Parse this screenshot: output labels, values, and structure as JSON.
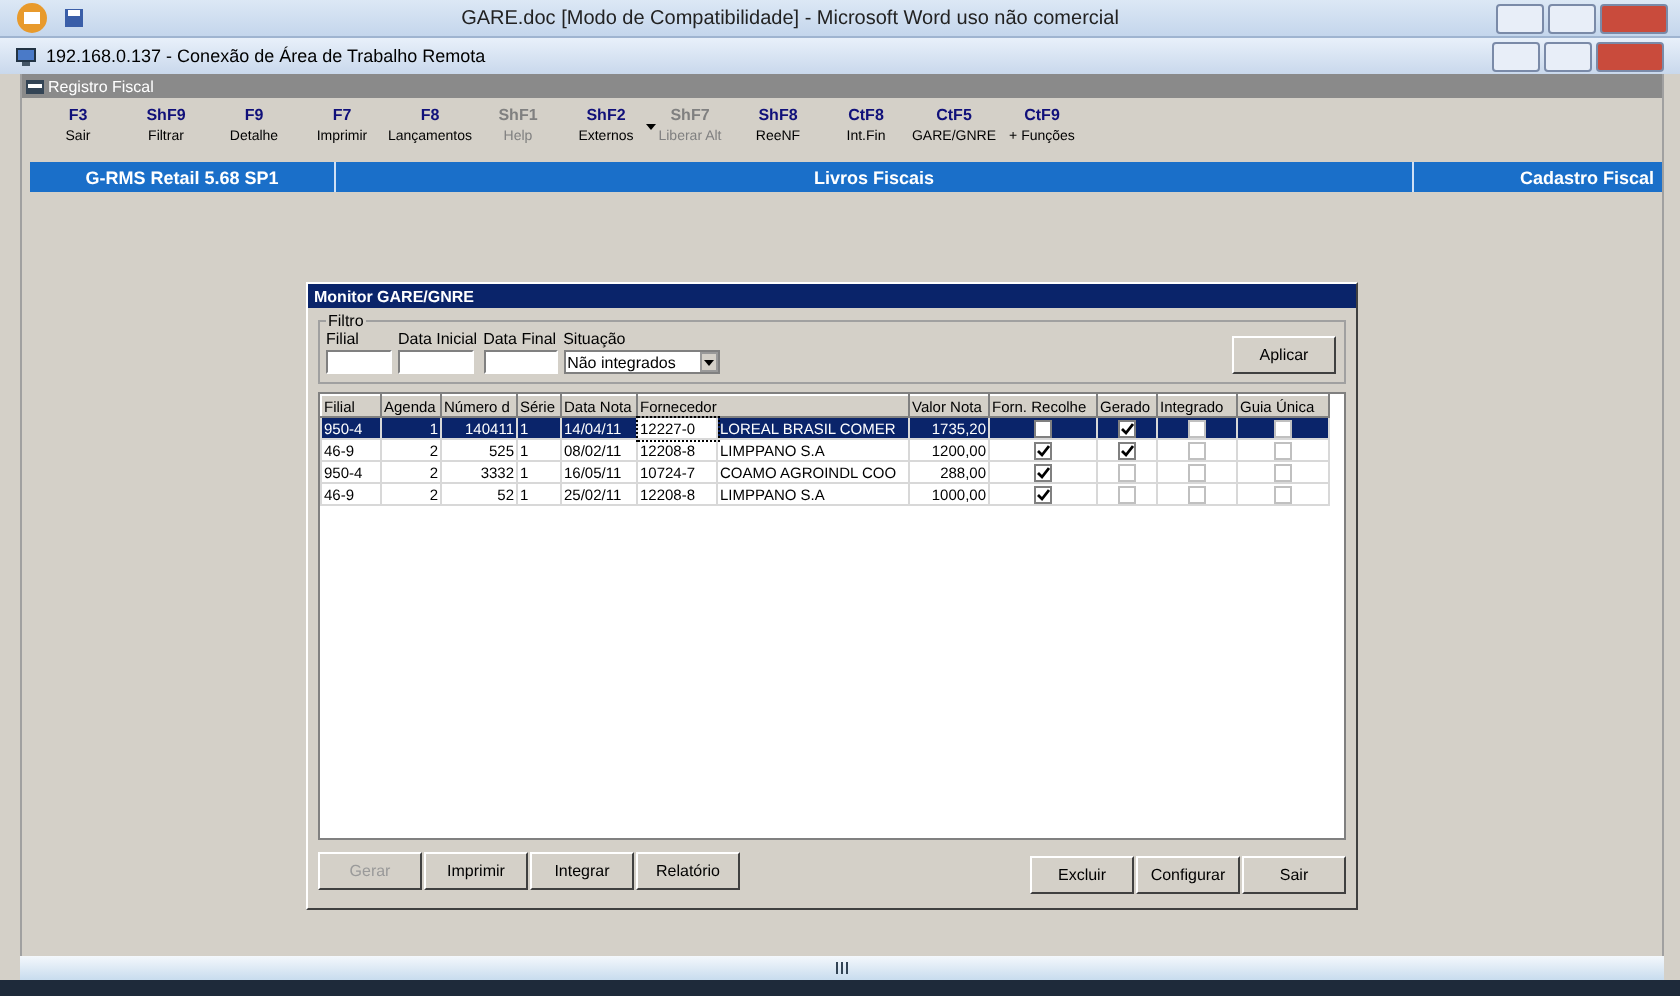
{
  "word_window": {
    "title": "GARE.doc [Modo de Compatibilidade] - Microsoft Word uso não comercial"
  },
  "remote_window": {
    "title": "192.168.0.137 - Conexão de Área de Trabalho Remota"
  },
  "app_window": {
    "title": "Registro Fiscal"
  },
  "toolbar": [
    {
      "key": "F3",
      "label": "Sair",
      "disabled": false,
      "menu": false
    },
    {
      "key": "ShF9",
      "label": "Filtrar",
      "disabled": false,
      "menu": false
    },
    {
      "key": "F9",
      "label": "Detalhe",
      "disabled": false,
      "menu": false
    },
    {
      "key": "F7",
      "label": "Imprimir",
      "disabled": false,
      "menu": false
    },
    {
      "key": "F8",
      "label": "Lançamentos",
      "disabled": false,
      "menu": false
    },
    {
      "key": "ShF1",
      "label": "Help",
      "disabled": true,
      "menu": false
    },
    {
      "key": "ShF2",
      "label": "Externos",
      "disabled": false,
      "menu": true
    },
    {
      "key": "ShF7",
      "label": "Liberar Alt",
      "disabled": true,
      "menu": false
    },
    {
      "key": "ShF8",
      "label": "ReeNF",
      "disabled": false,
      "menu": false
    },
    {
      "key": "CtF8",
      "label": "Int.Fin",
      "disabled": false,
      "menu": false
    },
    {
      "key": "CtF5",
      "label": "GARE/GNRE",
      "disabled": false,
      "menu": false
    },
    {
      "key": "CtF9",
      "label": "+ Funções",
      "disabled": false,
      "menu": false
    }
  ],
  "status_bar": [
    "G-RMS Retail 5.68 SP1",
    "Livros Fiscais",
    "Cadastro Fiscal"
  ],
  "dialog": {
    "title": "Monitor GARE/GNRE",
    "filter": {
      "legend": "Filtro",
      "fields": [
        {
          "label": "Filial"
        },
        {
          "label": "Data Inicial"
        },
        {
          "label": "Data Final"
        }
      ],
      "situacao": {
        "label": "Situação",
        "value": "Não integrados"
      },
      "apply_button": "Aplicar"
    },
    "table": {
      "columns": [
        "Filial",
        "Agenda",
        "Número d",
        "Série",
        "Data Nota",
        "Fornecedor",
        "Valor Nota",
        "Forn. Recolhe",
        "Gerado",
        "Integrado",
        "Guia Única"
      ],
      "rows": [
        {
          "selected": true,
          "filial": "950-4",
          "agenda": "1",
          "numero": "140411",
          "serie": "1",
          "data_nota": "14/04/11",
          "fornecedor_codigo": "12227-0",
          "fornecedor_nome": "LOREAL BRASIL COMER",
          "valor_nota": "1735,20",
          "forn_recolhe": false,
          "gerado": true,
          "integrado": false,
          "guia_unica": false
        },
        {
          "selected": false,
          "filial": "46-9",
          "agenda": "2",
          "numero": "525",
          "serie": "1",
          "data_nota": "08/02/11",
          "fornecedor_codigo": "12208-8",
          "fornecedor_nome": "LIMPPANO S.A",
          "valor_nota": "1200,00",
          "forn_recolhe": true,
          "gerado": true,
          "integrado": false,
          "guia_unica": false
        },
        {
          "selected": false,
          "filial": "950-4",
          "agenda": "2",
          "numero": "3332",
          "serie": "1",
          "data_nota": "16/05/11",
          "fornecedor_codigo": "10724-7",
          "fornecedor_nome": "COAMO AGROINDL COO",
          "valor_nota": "288,00",
          "forn_recolhe": true,
          "gerado": false,
          "integrado": false,
          "guia_unica": false
        },
        {
          "selected": false,
          "filial": "46-9",
          "agenda": "2",
          "numero": "52",
          "serie": "1",
          "data_nota": "25/02/11",
          "fornecedor_codigo": "12208-8",
          "fornecedor_nome": "LIMPPANO S.A",
          "valor_nota": "1000,00",
          "forn_recolhe": true,
          "gerado": false,
          "integrado": false,
          "guia_unica": false
        }
      ]
    },
    "buttons_left": [
      {
        "label": "Gerar",
        "disabled": true
      },
      {
        "label": "Imprimir",
        "disabled": false
      },
      {
        "label": "Integrar",
        "disabled": false
      },
      {
        "label": "Relatório",
        "disabled": false
      }
    ],
    "buttons_right": [
      {
        "label": "Excluir",
        "disabled": false
      },
      {
        "label": "Configurar",
        "disabled": false
      },
      {
        "label": "Sair",
        "disabled": false
      }
    ]
  }
}
